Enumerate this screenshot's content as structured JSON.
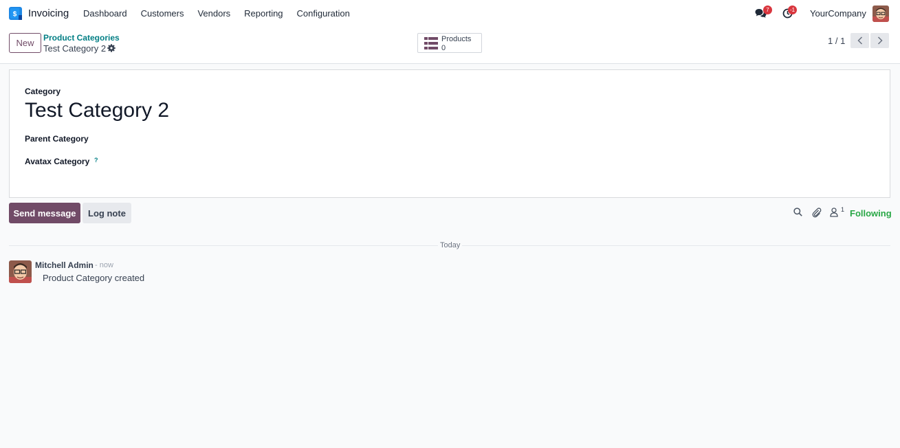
{
  "navbar": {
    "app_name": "Invoicing",
    "menu": [
      "Dashboard",
      "Customers",
      "Vendors",
      "Reporting",
      "Configuration"
    ],
    "messages_badge": "7",
    "activities_badge": "-1",
    "company": "YourCompany"
  },
  "control": {
    "new_label": "New",
    "breadcrumb_parent": "Product Categories",
    "breadcrumb_current": "Test Category 2",
    "smart_button": {
      "label": "Products",
      "value": "0"
    },
    "pager": "1 / 1"
  },
  "form": {
    "name_label": "Category",
    "name_value": "Test Category 2",
    "parent_label": "Parent Category",
    "avatax_label": "Avatax Category",
    "help_mark": "?"
  },
  "chatter": {
    "send_label": "Send message",
    "log_label": "Log note",
    "follower_count": "1",
    "following_label": "Following",
    "date_divider": "Today",
    "message": {
      "author": "Mitchell Admin",
      "date": "- now",
      "body": "Product Category created"
    }
  },
  "colors": {
    "brand": "#714b67",
    "link": "#017e84",
    "following": "#28a745",
    "badge": "#d9363e"
  }
}
